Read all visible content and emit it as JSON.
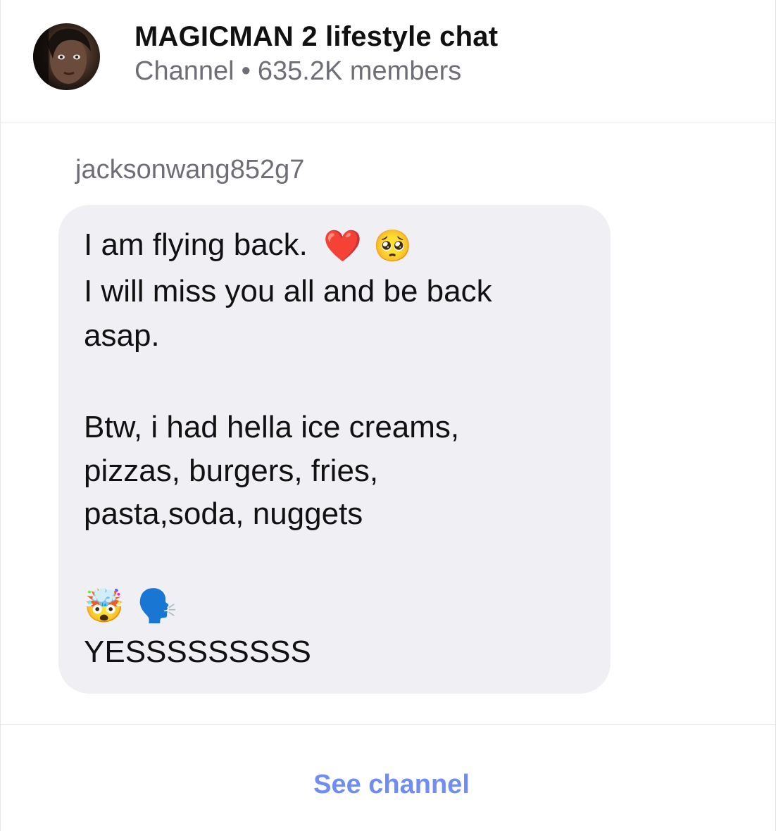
{
  "header": {
    "channel_title": "MAGICMAN 2 lifestyle chat",
    "channel_type": "Channel",
    "separator": "•",
    "members": "635.2K members",
    "avatar_icon": "channel-avatar"
  },
  "message": {
    "sender": "jacksonwang852g7",
    "lines": [
      "I am flying back.",
      "I will miss you all and be back",
      "asap.",
      "Btw, i had hella ice creams,",
      "pizzas, burgers, fries,",
      "pasta,soda, nuggets",
      "YESSSSSSSSS"
    ],
    "emojis": {
      "heart": "❤️",
      "pleading": "🥺",
      "mind_blown": "🤯",
      "speaking_head": "🗣️"
    },
    "bubble_color": "#efeff4"
  },
  "footer": {
    "see_channel_label": "See channel",
    "accent_color": "#6f8df2"
  }
}
